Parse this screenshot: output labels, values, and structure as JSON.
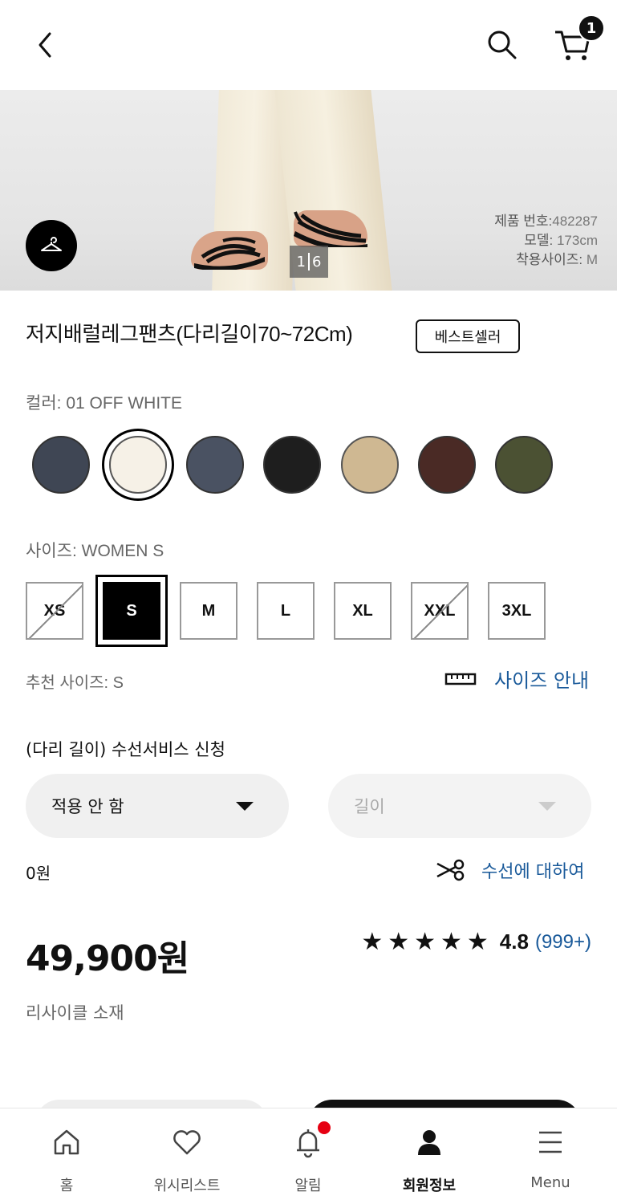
{
  "header": {
    "cart_count": "1"
  },
  "hero": {
    "pager_current": "1",
    "pager_total": "6",
    "info": {
      "product_no_label": "제품 번호:",
      "product_no": "482287",
      "model_label": "모델:",
      "model": " 173cm",
      "fit_size_label": "착용사이즈:",
      "fit_size": " M"
    }
  },
  "product": {
    "title": "저지배럴레그팬츠(다리길이70~72Cm)",
    "badge": "베스트셀러",
    "color_label": "컬러:",
    "color_value": " 01 OFF WHITE",
    "colors": [
      {
        "name": "navy",
        "hex": "#3f4654"
      },
      {
        "name": "off-white",
        "hex": "#f6f1e7"
      },
      {
        "name": "slate-blue",
        "hex": "#4a5262"
      },
      {
        "name": "black",
        "hex": "#1e1e1e"
      },
      {
        "name": "beige",
        "hex": "#cfb892"
      },
      {
        "name": "dark-brown",
        "hex": "#4a2a25"
      },
      {
        "name": "olive",
        "hex": "#4b5133"
      }
    ],
    "selected_color_index": 1,
    "size_label": "사이즈:",
    "size_value": " WOMEN S",
    "sizes": [
      {
        "label": "XS",
        "status": "soldout"
      },
      {
        "label": "S",
        "status": "selected"
      },
      {
        "label": "M",
        "status": "available"
      },
      {
        "label": "L",
        "status": "available"
      },
      {
        "label": "XL",
        "status": "available"
      },
      {
        "label": "XXL",
        "status": "soldout"
      },
      {
        "label": "3XL",
        "status": "available"
      }
    ],
    "recommended_label": "추천 사이즈:",
    "recommended_value": " S",
    "size_guide_label": "사이즈 안내",
    "alteration_title": "(다리 길이) 수선서비스 신청",
    "alteration_select": "적용 안 함",
    "length_select_placeholder": "길이",
    "alteration_price": "0원",
    "about_alteration": "수선에 대하여",
    "price": "49,900원",
    "rating_stars": "★★★★★",
    "rating_value": 4.8,
    "rating_score": "4.8",
    "review_count": "(999+)",
    "material_note": "리사이클 소재"
  },
  "nav": {
    "home": "홈",
    "wishlist": "위시리스트",
    "notifications": "알림",
    "member": "회원정보",
    "menu": "Menu"
  },
  "colors": {
    "link": "#1a5a9a",
    "notification_dot": "#e60012"
  }
}
